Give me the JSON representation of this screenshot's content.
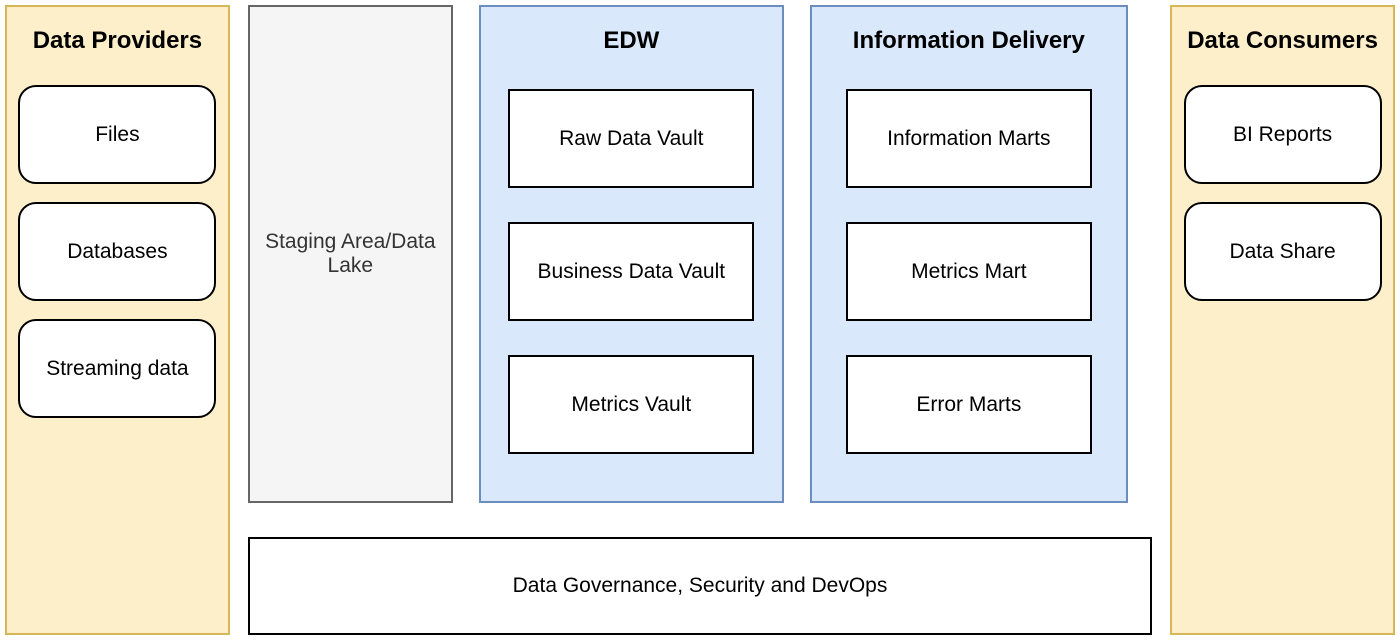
{
  "providers": {
    "title": "Data Providers",
    "items": [
      "Files",
      "Databases",
      "Streaming data"
    ]
  },
  "staging": {
    "label": "Staging Area/Data Lake"
  },
  "edw": {
    "title": "EDW",
    "items": [
      "Raw Data Vault",
      "Business Data Vault",
      "Metrics Vault"
    ]
  },
  "delivery": {
    "title": "Information Delivery",
    "items": [
      "Information Marts",
      "Metrics Mart",
      "Error Marts"
    ]
  },
  "consumers": {
    "title": "Data Consumers",
    "items": [
      "BI Reports",
      "Data Share"
    ]
  },
  "governance": {
    "label": "Data Governance, Security and DevOps"
  }
}
